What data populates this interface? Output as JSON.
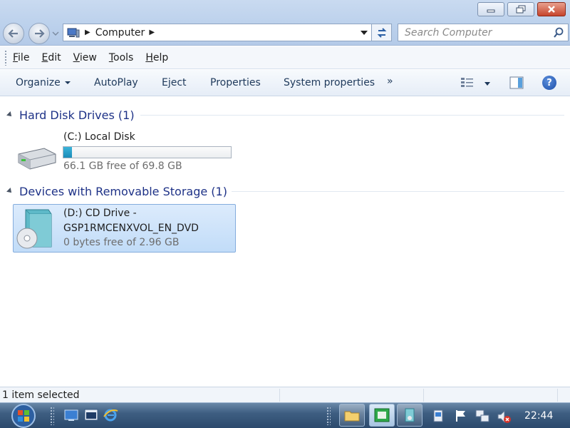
{
  "window": {
    "controls": [
      "minimize",
      "maximize",
      "close"
    ]
  },
  "address": {
    "location": "Computer",
    "icon": "computer-icon"
  },
  "search": {
    "placeholder": "Search Computer"
  },
  "menu": [
    {
      "label": "File",
      "accel": "F",
      "rest": "ile"
    },
    {
      "label": "Edit",
      "accel": "E",
      "rest": "dit"
    },
    {
      "label": "View",
      "accel": "V",
      "rest": "iew"
    },
    {
      "label": "Tools",
      "accel": "T",
      "rest": "ools"
    },
    {
      "label": "Help",
      "accel": "H",
      "rest": "elp"
    }
  ],
  "commands": {
    "organize": "Organize",
    "autoplay": "AutoPlay",
    "eject": "Eject",
    "properties": "Properties",
    "system_properties": "System properties",
    "more": "»"
  },
  "groups": [
    {
      "title": "Hard Disk Drives (1)",
      "drives": [
        {
          "name": "(C:) Local Disk",
          "free": "66.1 GB free of 69.8 GB",
          "used_fraction": 0.053,
          "icon": "hard-disk-icon"
        }
      ]
    },
    {
      "title": "Devices with Removable Storage (1)",
      "drives": [
        {
          "name_line1": "(D:) CD Drive -",
          "name_line2": "GSP1RMCENXVOL_EN_DVD",
          "free": "0 bytes free of 2.96 GB",
          "icon": "cd-drive-icon",
          "selected": true
        }
      ]
    }
  ],
  "status": {
    "text": "1 item selected"
  },
  "taskbar": {
    "clock": "22:44"
  },
  "colors": {
    "group_title": "#1e3287",
    "selection": "#c1dcf8",
    "drive_bar_fill": "#1b8cb8"
  }
}
